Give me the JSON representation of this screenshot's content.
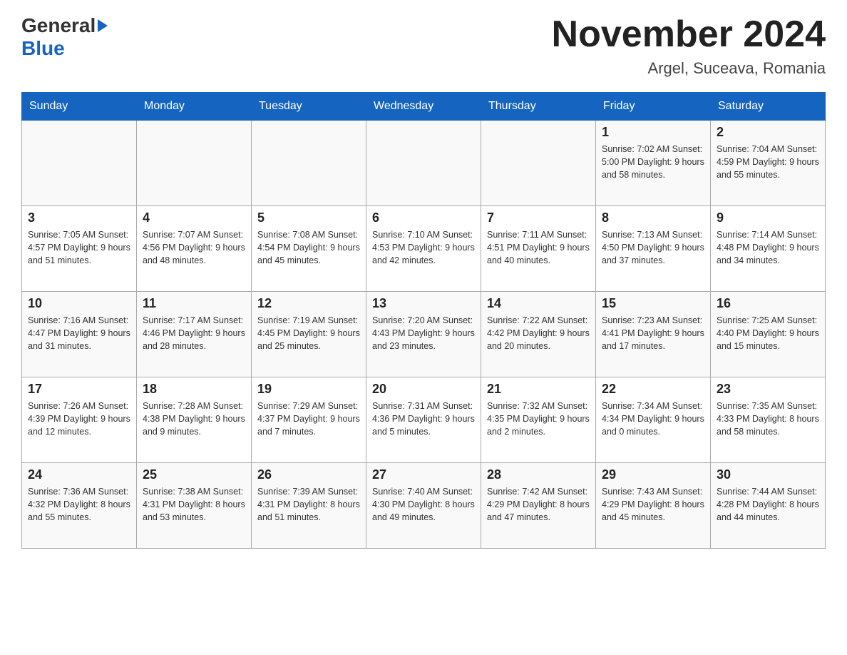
{
  "header": {
    "logo_general": "General",
    "logo_blue": "Blue",
    "month_title": "November 2024",
    "location": "Argel, Suceava, Romania"
  },
  "days_of_week": [
    "Sunday",
    "Monday",
    "Tuesday",
    "Wednesday",
    "Thursday",
    "Friday",
    "Saturday"
  ],
  "weeks": [
    {
      "days": [
        {
          "number": "",
          "info": ""
        },
        {
          "number": "",
          "info": ""
        },
        {
          "number": "",
          "info": ""
        },
        {
          "number": "",
          "info": ""
        },
        {
          "number": "",
          "info": ""
        },
        {
          "number": "1",
          "info": "Sunrise: 7:02 AM\nSunset: 5:00 PM\nDaylight: 9 hours and 58 minutes."
        },
        {
          "number": "2",
          "info": "Sunrise: 7:04 AM\nSunset: 4:59 PM\nDaylight: 9 hours and 55 minutes."
        }
      ]
    },
    {
      "days": [
        {
          "number": "3",
          "info": "Sunrise: 7:05 AM\nSunset: 4:57 PM\nDaylight: 9 hours and 51 minutes."
        },
        {
          "number": "4",
          "info": "Sunrise: 7:07 AM\nSunset: 4:56 PM\nDaylight: 9 hours and 48 minutes."
        },
        {
          "number": "5",
          "info": "Sunrise: 7:08 AM\nSunset: 4:54 PM\nDaylight: 9 hours and 45 minutes."
        },
        {
          "number": "6",
          "info": "Sunrise: 7:10 AM\nSunset: 4:53 PM\nDaylight: 9 hours and 42 minutes."
        },
        {
          "number": "7",
          "info": "Sunrise: 7:11 AM\nSunset: 4:51 PM\nDaylight: 9 hours and 40 minutes."
        },
        {
          "number": "8",
          "info": "Sunrise: 7:13 AM\nSunset: 4:50 PM\nDaylight: 9 hours and 37 minutes."
        },
        {
          "number": "9",
          "info": "Sunrise: 7:14 AM\nSunset: 4:48 PM\nDaylight: 9 hours and 34 minutes."
        }
      ]
    },
    {
      "days": [
        {
          "number": "10",
          "info": "Sunrise: 7:16 AM\nSunset: 4:47 PM\nDaylight: 9 hours and 31 minutes."
        },
        {
          "number": "11",
          "info": "Sunrise: 7:17 AM\nSunset: 4:46 PM\nDaylight: 9 hours and 28 minutes."
        },
        {
          "number": "12",
          "info": "Sunrise: 7:19 AM\nSunset: 4:45 PM\nDaylight: 9 hours and 25 minutes."
        },
        {
          "number": "13",
          "info": "Sunrise: 7:20 AM\nSunset: 4:43 PM\nDaylight: 9 hours and 23 minutes."
        },
        {
          "number": "14",
          "info": "Sunrise: 7:22 AM\nSunset: 4:42 PM\nDaylight: 9 hours and 20 minutes."
        },
        {
          "number": "15",
          "info": "Sunrise: 7:23 AM\nSunset: 4:41 PM\nDaylight: 9 hours and 17 minutes."
        },
        {
          "number": "16",
          "info": "Sunrise: 7:25 AM\nSunset: 4:40 PM\nDaylight: 9 hours and 15 minutes."
        }
      ]
    },
    {
      "days": [
        {
          "number": "17",
          "info": "Sunrise: 7:26 AM\nSunset: 4:39 PM\nDaylight: 9 hours and 12 minutes."
        },
        {
          "number": "18",
          "info": "Sunrise: 7:28 AM\nSunset: 4:38 PM\nDaylight: 9 hours and 9 minutes."
        },
        {
          "number": "19",
          "info": "Sunrise: 7:29 AM\nSunset: 4:37 PM\nDaylight: 9 hours and 7 minutes."
        },
        {
          "number": "20",
          "info": "Sunrise: 7:31 AM\nSunset: 4:36 PM\nDaylight: 9 hours and 5 minutes."
        },
        {
          "number": "21",
          "info": "Sunrise: 7:32 AM\nSunset: 4:35 PM\nDaylight: 9 hours and 2 minutes."
        },
        {
          "number": "22",
          "info": "Sunrise: 7:34 AM\nSunset: 4:34 PM\nDaylight: 9 hours and 0 minutes."
        },
        {
          "number": "23",
          "info": "Sunrise: 7:35 AM\nSunset: 4:33 PM\nDaylight: 8 hours and 58 minutes."
        }
      ]
    },
    {
      "days": [
        {
          "number": "24",
          "info": "Sunrise: 7:36 AM\nSunset: 4:32 PM\nDaylight: 8 hours and 55 minutes."
        },
        {
          "number": "25",
          "info": "Sunrise: 7:38 AM\nSunset: 4:31 PM\nDaylight: 8 hours and 53 minutes."
        },
        {
          "number": "26",
          "info": "Sunrise: 7:39 AM\nSunset: 4:31 PM\nDaylight: 8 hours and 51 minutes."
        },
        {
          "number": "27",
          "info": "Sunrise: 7:40 AM\nSunset: 4:30 PM\nDaylight: 8 hours and 49 minutes."
        },
        {
          "number": "28",
          "info": "Sunrise: 7:42 AM\nSunset: 4:29 PM\nDaylight: 8 hours and 47 minutes."
        },
        {
          "number": "29",
          "info": "Sunrise: 7:43 AM\nSunset: 4:29 PM\nDaylight: 8 hours and 45 minutes."
        },
        {
          "number": "30",
          "info": "Sunrise: 7:44 AM\nSunset: 4:28 PM\nDaylight: 8 hours and 44 minutes."
        }
      ]
    }
  ]
}
